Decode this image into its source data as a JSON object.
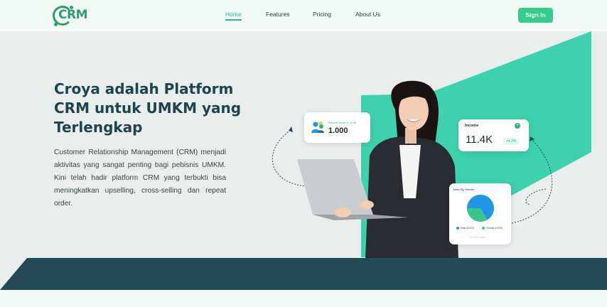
{
  "nav": {
    "logo_text": "CRM",
    "links": [
      "Home",
      "Features",
      "Pricing",
      "About Us"
    ],
    "active_link": "Home",
    "signin_label": "Sign In"
  },
  "hero": {
    "title": "Croya adalah Platform CRM untuk UMKM yang Terlengkap",
    "description": "Customer Relationship Management (CRM) menjadi aktivitas yang sangat penting bagi pebisnis UMKM. Kini telah hadir platform CRM yang terbukti bisa meningkatkan upselling, cross-selling dan repeat order."
  },
  "cards": {
    "repeat_order": {
      "label": "Repeat Order (U.S.dt)",
      "value": "1.000"
    },
    "income": {
      "label": "Income",
      "value": "11.4K",
      "badge": "+4.3%"
    },
    "sales_by_gender": {
      "label": "Sales By Gender",
      "legend": [
        "Male (8,000)",
        "Female (4,000)"
      ],
      "footer": "10,000 Data",
      "chart_data": {
        "type": "pie",
        "title": "Sales By Gender",
        "series": [
          {
            "name": "Male",
            "value": 8000
          },
          {
            "name": "Female",
            "value": 4000
          }
        ]
      }
    }
  },
  "colors": {
    "brand": "#33cc8f",
    "accent_green": "#3dd1ad",
    "dark_band": "#254a55",
    "blue": "#2196e8",
    "heading": "#1e4450"
  }
}
